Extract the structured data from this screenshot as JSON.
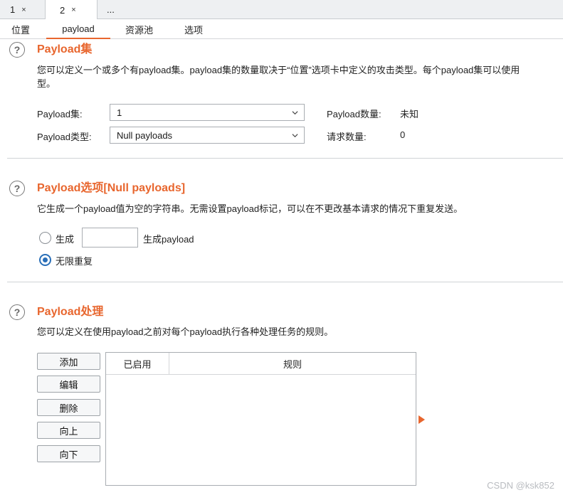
{
  "top_tabs": [
    {
      "label": "1",
      "close": "×"
    },
    {
      "label": "2",
      "close": "×"
    },
    {
      "label": "..."
    }
  ],
  "sub_tabs": [
    "位置",
    "payload",
    "资源池",
    "选项"
  ],
  "payload_sets": {
    "title": "Payload集",
    "desc_line1": "您可以定义一个或多个有payload集。payload集的数量取决于“位置”选项卡中定义的攻击类型。每个payload集可以使用",
    "desc_line2": "型。",
    "set_label": "Payload集:",
    "set_value": "1",
    "type_label": "Payload类型:",
    "type_value": "Null payloads",
    "count_label": "Payload数量:",
    "count_value": "未知",
    "request_label": "请求数量:",
    "request_value": "0"
  },
  "payload_options": {
    "title": "Payload选项[Null payloads]",
    "desc": "它生成一个payload值为空的字符串。无需设置payload标记，可以在不更改基本请求的情况下重复发送。",
    "generate_label": "生成",
    "generate_value": "",
    "generate_suffix": "生成payload",
    "infinite_label": "无限重复"
  },
  "payload_processing": {
    "title": "Payload处理",
    "desc": "您可以定义在使用payload之前对每个payload执行各种处理任务的规则。",
    "buttons": [
      "添加",
      "编辑",
      "删除",
      "向上",
      "向下"
    ],
    "columns": [
      "已启用",
      "规则"
    ]
  },
  "help_glyph": "?",
  "watermark": "CSDN @ksk852",
  "colors": {
    "accent": "#e8662e",
    "radio": "#2a6fb8"
  },
  "icons": {
    "help": "question-circle-icon",
    "chevron": "chevron-down-icon",
    "arrow": "triangle-right-icon"
  }
}
